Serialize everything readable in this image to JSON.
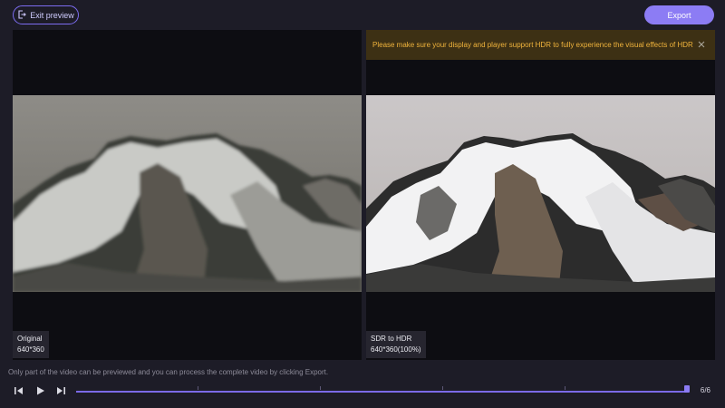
{
  "header": {
    "exit_label": "Exit preview",
    "export_label": "Export"
  },
  "notice": {
    "text": "Please make sure your display and player support HDR to fully experience the visual effects of HDR"
  },
  "left_pane": {
    "label": "Original",
    "resolution": "640*360"
  },
  "right_pane": {
    "label": "SDR to HDR",
    "resolution": "640*360(100%)"
  },
  "footer": {
    "hint": "Only part of the video can be previewed and you can process the complete video by clicking Export.",
    "counter": "6/6",
    "progress": 1.0
  },
  "colors": {
    "accent": "#8c7cf4",
    "notice_bg": "#3d3014",
    "notice_text": "#f1b43c",
    "background": "#1d1c27"
  }
}
